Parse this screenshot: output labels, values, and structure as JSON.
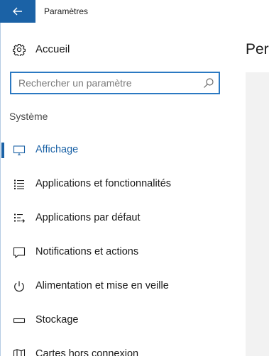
{
  "window": {
    "title": "Paramètres",
    "accent": "#1b62a6"
  },
  "titlebar": {
    "back_icon": "arrow-left-icon"
  },
  "sidebar": {
    "home": {
      "label": "Accueil",
      "icon": "gear-icon"
    },
    "search": {
      "placeholder": "Rechercher un paramètre",
      "value": "",
      "icon": "search-icon"
    },
    "section": "Système",
    "items": [
      {
        "label": "Affichage",
        "icon": "monitor-icon",
        "selected": true
      },
      {
        "label": "Applications et fonctionnalités",
        "icon": "app-list-icon",
        "selected": false
      },
      {
        "label": "Applications par défaut",
        "icon": "default-apps-icon",
        "selected": false
      },
      {
        "label": "Notifications et actions",
        "icon": "notification-icon",
        "selected": false
      },
      {
        "label": "Alimentation et mise en veille",
        "icon": "power-icon",
        "selected": false
      },
      {
        "label": "Stockage",
        "icon": "storage-icon",
        "selected": false
      },
      {
        "label": "Cartes hors connexion",
        "icon": "map-icon",
        "selected": false
      }
    ]
  },
  "content": {
    "title": "Per"
  }
}
